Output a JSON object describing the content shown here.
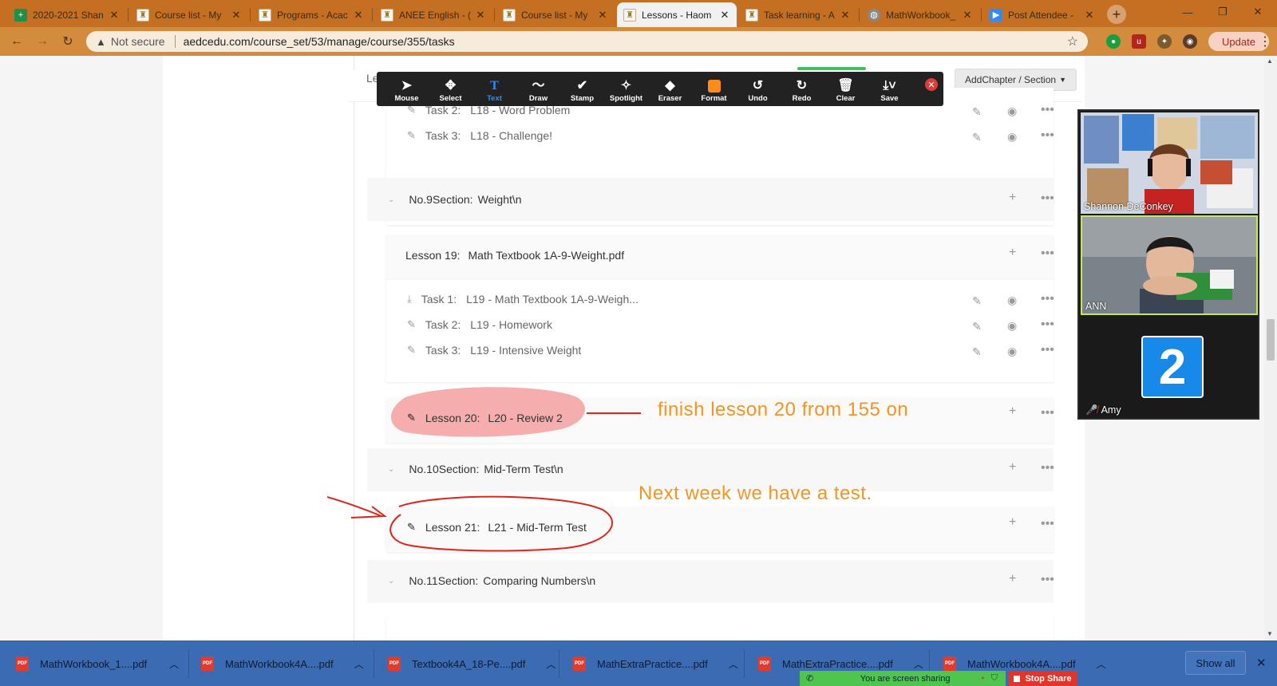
{
  "browser": {
    "tabs": [
      {
        "title": "2020-2021 Shan",
        "favicon": "sheets-icon"
      },
      {
        "title": "Course list - My",
        "favicon": "lock-badge-icon"
      },
      {
        "title": "Programs - Acac",
        "favicon": "lock-badge-icon"
      },
      {
        "title": "ANEE English - (",
        "favicon": "lock-badge-icon"
      },
      {
        "title": "Course list - My",
        "favicon": "lock-badge-icon"
      },
      {
        "title": "Lessons - Haom",
        "favicon": "lock-badge-icon",
        "active": true
      },
      {
        "title": "Task learning - A",
        "favicon": "lock-badge-icon"
      },
      {
        "title": "MathWorkbook_",
        "favicon": "globe-icon"
      },
      {
        "title": "Post Attendee -",
        "favicon": "zoom-icon"
      }
    ],
    "security": "Not secure",
    "url": "aedcedu.com/course_set/53/manage/course/355/tasks",
    "update_label": "Update"
  },
  "toolbar": {
    "tools": [
      "Mouse",
      "Select",
      "Text",
      "Draw",
      "Stamp",
      "Spotlight",
      "Eraser",
      "Format",
      "Undo",
      "Redo",
      "Clear",
      "Save"
    ]
  },
  "page": {
    "header_fragment": "Le",
    "add_chapter": "AddChapter / Section",
    "tasks_l18": [
      {
        "num": "Task 2:",
        "title": "L18 - Word Problem"
      },
      {
        "num": "Task 3:",
        "title": "L18 - Challenge!"
      }
    ],
    "section9": {
      "num": "No.9Section:",
      "title": "Weight\\n"
    },
    "lesson19": {
      "num": "Lesson 19:",
      "title": "Math Textbook 1A-9-Weight.pdf"
    },
    "tasks_l19": [
      {
        "num": "Task 1:",
        "title": "L19 - Math Textbook 1A-9-Weigh..."
      },
      {
        "num": "Task 2:",
        "title": "L19 - Homework"
      },
      {
        "num": "Task 3:",
        "title": "L19 - Intensive Weight"
      }
    ],
    "lesson20": {
      "num": "Lesson 20:",
      "title": "L20 - Review 2"
    },
    "section10": {
      "num": "No.10Section:",
      "title": "Mid-Term Test\\n"
    },
    "lesson21": {
      "num": "Lesson 21:",
      "title": "L21 - Mid-Term Test"
    },
    "section11": {
      "num": "No.11Section:",
      "title": "Comparing Numbers\\n"
    }
  },
  "annotations": {
    "note1": "finish lesson 20 from 155 on",
    "note2": "Next week we have a test.",
    "highlight_color": "#f4a6a6",
    "ink_color": "#e0241b",
    "text_color": "#f7931e"
  },
  "video": {
    "participants": [
      {
        "name": "Shannon DeConkey"
      },
      {
        "name": "ANN"
      },
      {
        "name": "Amy",
        "avatar_number": "2",
        "muted": true
      }
    ]
  },
  "downloads": {
    "items": [
      "MathWorkbook_1....pdf",
      "MathWorkbook4A....pdf",
      "Textbook4A_18-Pe....pdf",
      "MathExtraPractice....pdf",
      "MathExtraPractice....pdf",
      "MathWorkbook4A....pdf"
    ],
    "show_all": "Show all"
  },
  "share": {
    "status": "You are screen sharing",
    "stop": "Stop Share"
  }
}
